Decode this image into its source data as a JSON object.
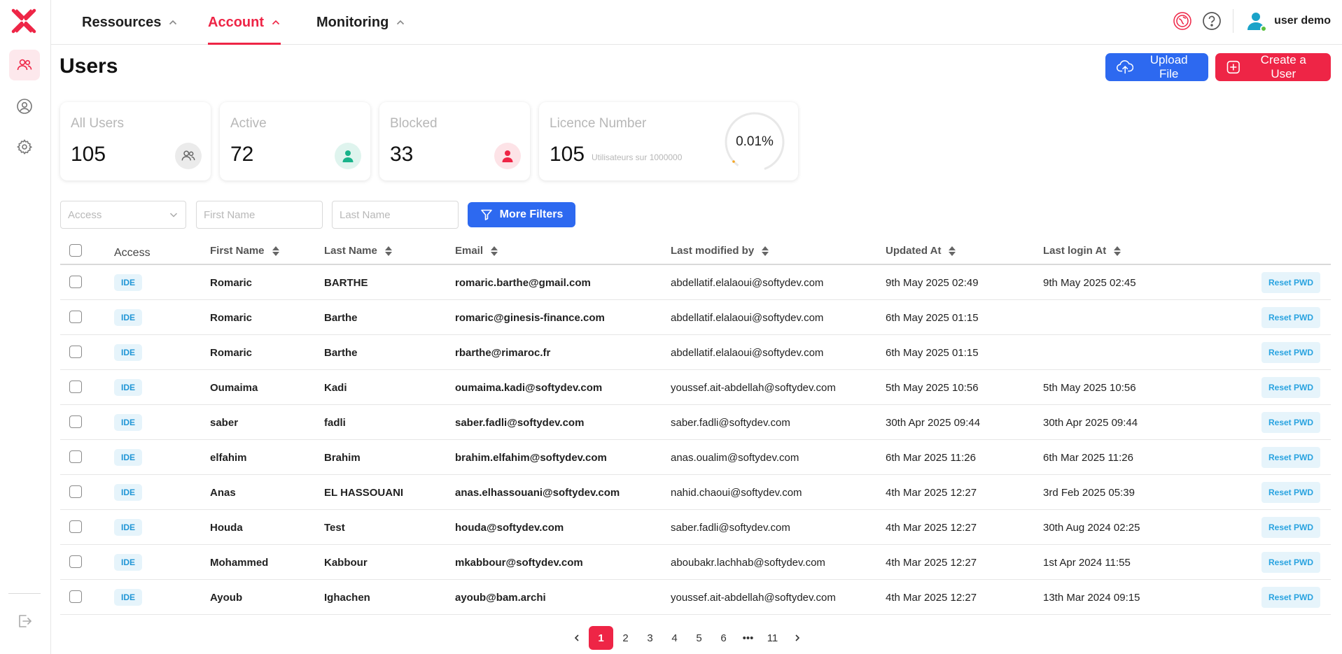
{
  "nav": {
    "items": [
      {
        "label": "Ressources"
      },
      {
        "label": "Account"
      },
      {
        "label": "Monitoring"
      }
    ]
  },
  "user": {
    "name": "user demo"
  },
  "page": {
    "title": "Users"
  },
  "actions": {
    "upload": "Upload File",
    "create": "Create a User"
  },
  "stats": {
    "all": {
      "label": "All Users",
      "value": "105"
    },
    "active": {
      "label": "Active",
      "value": "72"
    },
    "blocked": {
      "label": "Blocked",
      "value": "33"
    },
    "licence": {
      "label": "Licence Number",
      "value": "105",
      "sub": "Utilisateurs sur 1000000",
      "percent": "0.01%",
      "fraction": 0.0001
    }
  },
  "filters": {
    "access_placeholder": "Access",
    "first_name_placeholder": "First Name",
    "last_name_placeholder": "Last Name",
    "more": "More Filters"
  },
  "table": {
    "headers": {
      "access": "Access",
      "first_name": "First Name",
      "last_name": "Last Name",
      "email": "Email",
      "modified_by": "Last modified by",
      "updated": "Updated At",
      "last_login": "Last login At"
    },
    "reset_label": "Reset PWD",
    "rows": [
      {
        "access": "IDE",
        "first": "Romaric",
        "last": "BARTHE",
        "email": "romaric.barthe@gmail.com",
        "by": "abdellatif.elalaoui@softydev.com",
        "updated": "9th May 2025 02:49",
        "login": "9th May 2025 02:45"
      },
      {
        "access": "IDE",
        "first": "Romaric",
        "last": "Barthe",
        "email": "romaric@ginesis-finance.com",
        "by": "abdellatif.elalaoui@softydev.com",
        "updated": "6th May 2025 01:15",
        "login": ""
      },
      {
        "access": "IDE",
        "first": "Romaric",
        "last": "Barthe",
        "email": "rbarthe@rimaroc.fr",
        "by": "abdellatif.elalaoui@softydev.com",
        "updated": "6th May 2025 01:15",
        "login": ""
      },
      {
        "access": "IDE",
        "first": "Oumaima",
        "last": "Kadi",
        "email": "oumaima.kadi@softydev.com",
        "by": "youssef.ait-abdellah@softydev.com",
        "updated": "5th May 2025 10:56",
        "login": "5th May 2025 10:56"
      },
      {
        "access": "IDE",
        "first": "saber",
        "last": "fadli",
        "email": "saber.fadli@softydev.com",
        "by": "saber.fadli@softydev.com",
        "updated": "30th Apr 2025 09:44",
        "login": "30th Apr 2025 09:44"
      },
      {
        "access": "IDE",
        "first": "elfahim",
        "last": "Brahim",
        "email": "brahim.elfahim@softydev.com",
        "by": "anas.oualim@softydev.com",
        "updated": "6th Mar 2025 11:26",
        "login": "6th Mar 2025 11:26"
      },
      {
        "access": "IDE",
        "first": "Anas",
        "last": "EL HASSOUANI",
        "email": "anas.elhassouani@softydev.com",
        "by": "nahid.chaoui@softydev.com",
        "updated": "4th Mar 2025 12:27",
        "login": "3rd Feb 2025 05:39"
      },
      {
        "access": "IDE",
        "first": "Houda",
        "last": "Test",
        "email": "houda@softydev.com",
        "by": "saber.fadli@softydev.com",
        "updated": "4th Mar 2025 12:27",
        "login": "30th Aug 2024 02:25"
      },
      {
        "access": "IDE",
        "first": "Mohammed",
        "last": "Kabbour",
        "email": "mkabbour@softydev.com",
        "by": "aboubakr.lachhab@softydev.com",
        "updated": "4th Mar 2025 12:27",
        "login": "1st Apr 2024 11:55"
      },
      {
        "access": "IDE",
        "first": "Ayoub",
        "last": "Ighachen",
        "email": "ayoub@bam.archi",
        "by": "youssef.ait-abdellah@softydev.com",
        "updated": "4th Mar 2025 12:27",
        "login": "13th Mar 2024 09:15"
      }
    ]
  },
  "pagination": {
    "pages": [
      "1",
      "2",
      "3",
      "4",
      "5",
      "6",
      "•••",
      "11"
    ],
    "current": "1"
  },
  "colors": {
    "accent": "#ee2546",
    "primary": "#2d69f0",
    "badge_bg": "#e6f4fb"
  }
}
